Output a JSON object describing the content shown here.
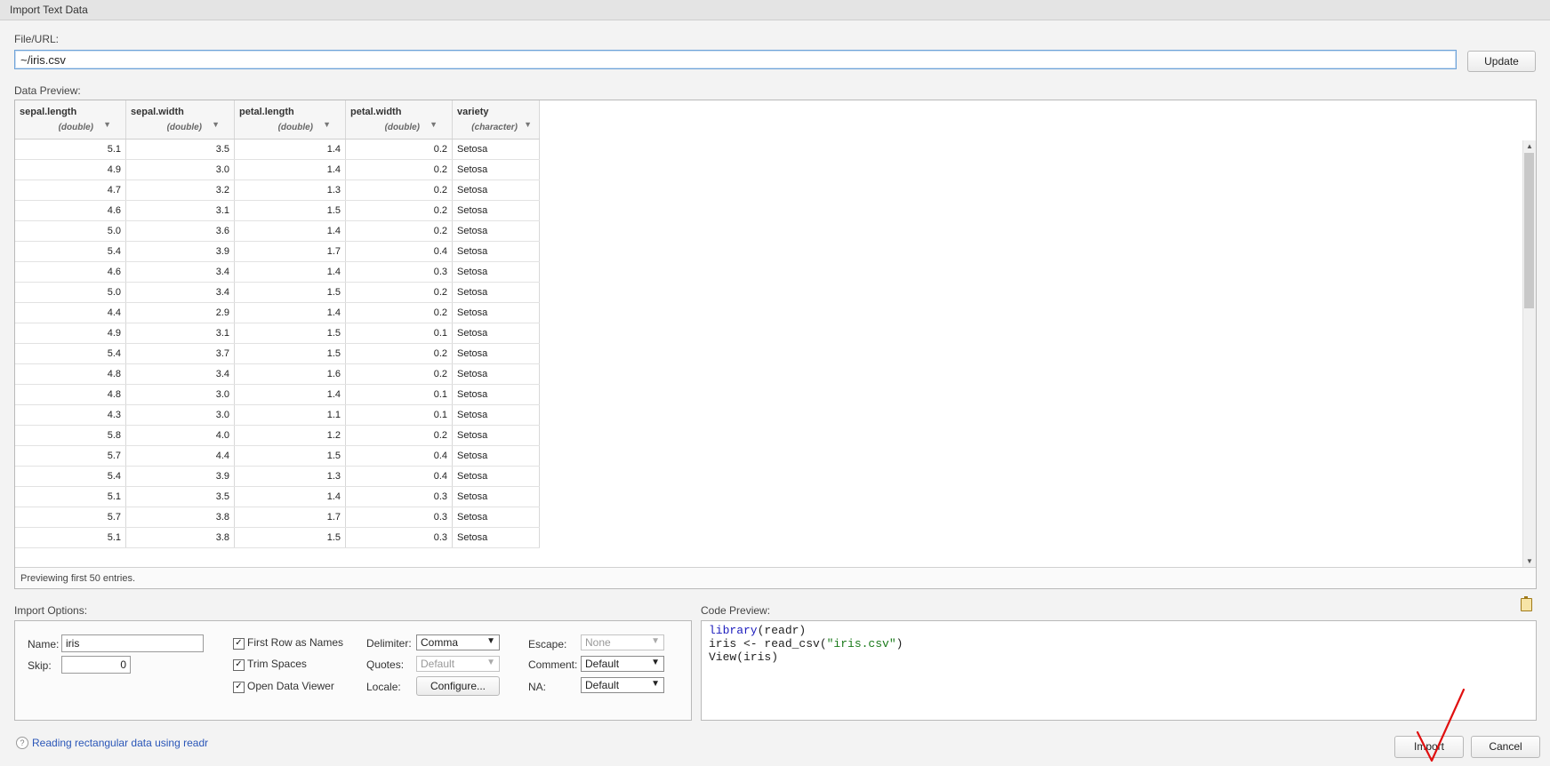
{
  "window": {
    "title": "Import Text Data"
  },
  "file": {
    "label": "File/URL:",
    "value": "~/iris.csv",
    "update_label": "Update"
  },
  "preview": {
    "label": "Data Preview:",
    "columns": [
      {
        "name": "sepal.length",
        "type": "(double)"
      },
      {
        "name": "sepal.width",
        "type": "(double)"
      },
      {
        "name": "petal.length",
        "type": "(double)"
      },
      {
        "name": "petal.width",
        "type": "(double)"
      },
      {
        "name": "variety",
        "type": "(character)"
      }
    ],
    "rows": [
      [
        "5.1",
        "3.5",
        "1.4",
        "0.2",
        "Setosa"
      ],
      [
        "4.9",
        "3.0",
        "1.4",
        "0.2",
        "Setosa"
      ],
      [
        "4.7",
        "3.2",
        "1.3",
        "0.2",
        "Setosa"
      ],
      [
        "4.6",
        "3.1",
        "1.5",
        "0.2",
        "Setosa"
      ],
      [
        "5.0",
        "3.6",
        "1.4",
        "0.2",
        "Setosa"
      ],
      [
        "5.4",
        "3.9",
        "1.7",
        "0.4",
        "Setosa"
      ],
      [
        "4.6",
        "3.4",
        "1.4",
        "0.3",
        "Setosa"
      ],
      [
        "5.0",
        "3.4",
        "1.5",
        "0.2",
        "Setosa"
      ],
      [
        "4.4",
        "2.9",
        "1.4",
        "0.2",
        "Setosa"
      ],
      [
        "4.9",
        "3.1",
        "1.5",
        "0.1",
        "Setosa"
      ],
      [
        "5.4",
        "3.7",
        "1.5",
        "0.2",
        "Setosa"
      ],
      [
        "4.8",
        "3.4",
        "1.6",
        "0.2",
        "Setosa"
      ],
      [
        "4.8",
        "3.0",
        "1.4",
        "0.1",
        "Setosa"
      ],
      [
        "4.3",
        "3.0",
        "1.1",
        "0.1",
        "Setosa"
      ],
      [
        "5.8",
        "4.0",
        "1.2",
        "0.2",
        "Setosa"
      ],
      [
        "5.7",
        "4.4",
        "1.5",
        "0.4",
        "Setosa"
      ],
      [
        "5.4",
        "3.9",
        "1.3",
        "0.4",
        "Setosa"
      ],
      [
        "5.1",
        "3.5",
        "1.4",
        "0.3",
        "Setosa"
      ],
      [
        "5.7",
        "3.8",
        "1.7",
        "0.3",
        "Setosa"
      ],
      [
        "5.1",
        "3.8",
        "1.5",
        "0.3",
        "Setosa"
      ]
    ],
    "footer": "Previewing first 50 entries."
  },
  "options": {
    "label": "Import Options:",
    "name_label": "Name:",
    "name_value": "iris",
    "skip_label": "Skip:",
    "skip_value": "0",
    "first_row_label": "First Row as Names",
    "first_row_checked": true,
    "trim_label": "Trim Spaces",
    "trim_checked": true,
    "open_viewer_label": "Open Data Viewer",
    "open_viewer_checked": true,
    "delimiter_label": "Delimiter:",
    "delimiter_value": "Comma",
    "quotes_label": "Quotes:",
    "quotes_value": "Default",
    "locale_label": "Locale:",
    "locale_button": "Configure...",
    "escape_label": "Escape:",
    "escape_value": "None",
    "comment_label": "Comment:",
    "comment_value": "Default",
    "na_label": "NA:",
    "na_value": "Default"
  },
  "code": {
    "label": "Code Preview:",
    "line1_fn": "library",
    "line1_rest": "(readr)",
    "line2_pre": "iris <- read_csv(",
    "line2_str": "\"iris.csv\"",
    "line2_post": ")",
    "line3": "View(iris)"
  },
  "footer": {
    "help_text": "Reading rectangular data using readr",
    "import_label": "Import",
    "cancel_label": "Cancel"
  },
  "colors": {
    "accent_link": "#2a56b8",
    "focus_border": "#6ea3d9",
    "annotation": "#e01010"
  }
}
